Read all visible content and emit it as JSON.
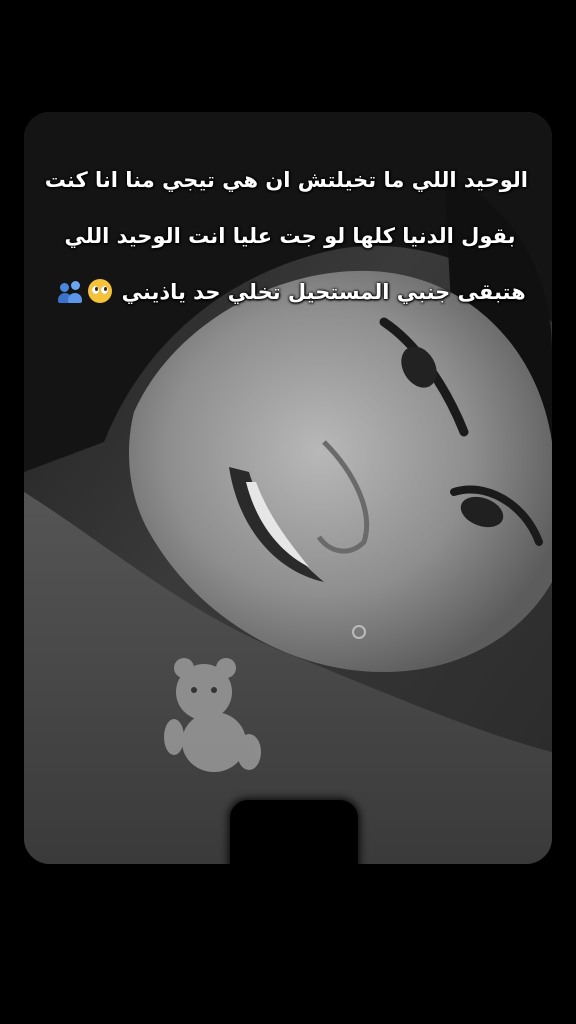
{
  "caption": {
    "line1": "الوحيد اللي ما تخيلتش ان هي تيجي منا  انا كنت",
    "line2": "بقول الدنيا كلها لو جت عليا انت الوحيد اللي",
    "line3": "هتبقى جنبي المستحيل تخلي حد ياذيني",
    "emojis": [
      "pleading-face-icon",
      "people-hugging-icon"
    ]
  },
  "colors": {
    "background": "#000000",
    "caption_text": "#ffffff"
  }
}
